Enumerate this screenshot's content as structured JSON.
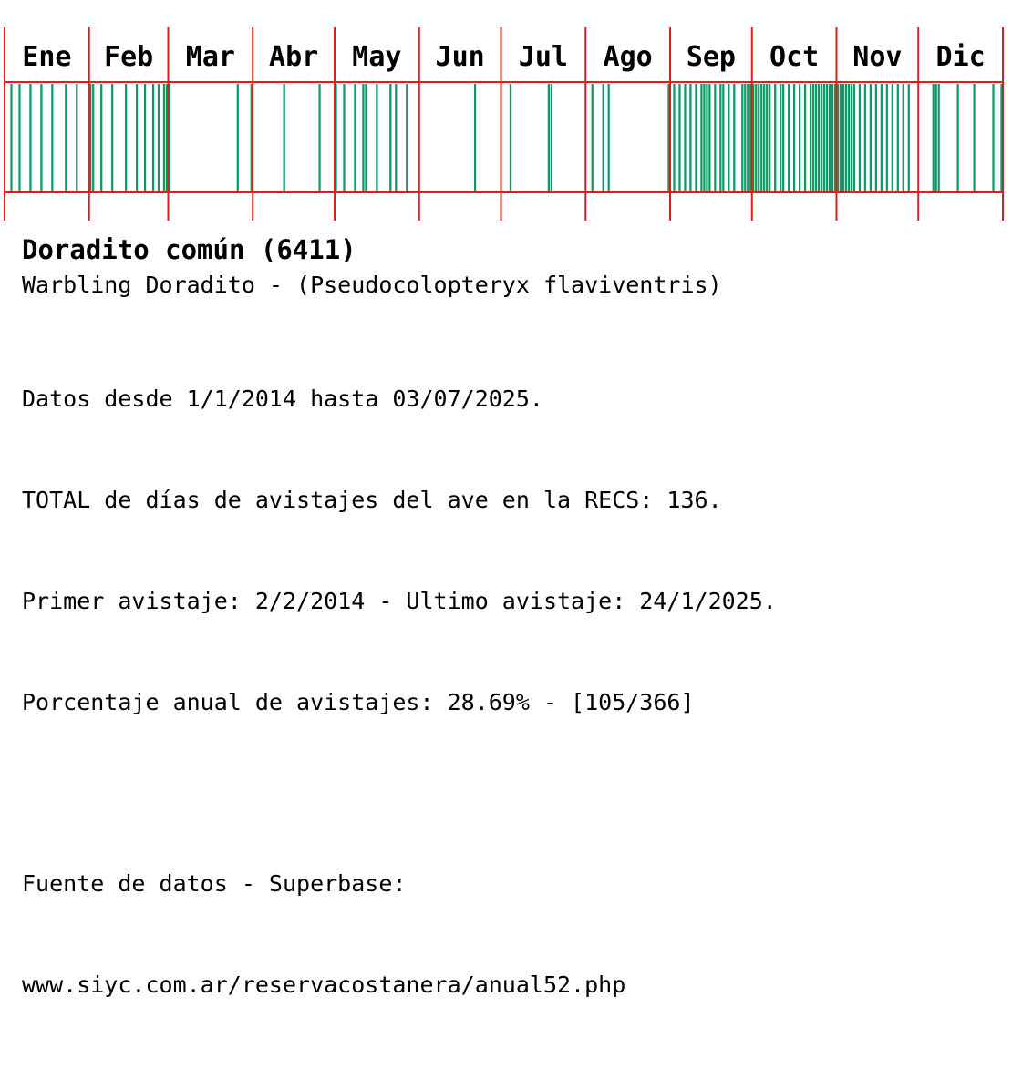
{
  "chart_data": {
    "type": "heatmap",
    "title": "",
    "months": [
      "Ene",
      "Feb",
      "Mar",
      "Abr",
      "May",
      "Jun",
      "Jul",
      "Ago",
      "Sep",
      "Oct",
      "Nov",
      "Dic"
    ],
    "days_in_months": [
      31,
      29,
      31,
      30,
      31,
      30,
      31,
      31,
      30,
      31,
      30,
      31
    ],
    "sighting_days_of_year": [
      3,
      6,
      10,
      14,
      18,
      23,
      27,
      32,
      33,
      36,
      40,
      45,
      49,
      52,
      55,
      57,
      59,
      60,
      61,
      86,
      91,
      103,
      116,
      122,
      125,
      129,
      132,
      133,
      137,
      142,
      144,
      148,
      173,
      186,
      200,
      201,
      216,
      220,
      222,
      244,
      246,
      248,
      250,
      252,
      254,
      256,
      257,
      258,
      259,
      261,
      263,
      264,
      266,
      268,
      271,
      272,
      273,
      274,
      275,
      276,
      277,
      278,
      279,
      280,
      281,
      283,
      285,
      286,
      288,
      290,
      292,
      294,
      296,
      297,
      298,
      299,
      300,
      301,
      302,
      303,
      304,
      305,
      306,
      307,
      308,
      309,
      310,
      311,
      312,
      314,
      316,
      318,
      320,
      322,
      324,
      326,
      328,
      330,
      332,
      341,
      342,
      343,
      350,
      356,
      363,
      366
    ],
    "colors": {
      "sighting": "#0c9b67",
      "grid": "#e51b1b",
      "background": "#ffffff"
    }
  },
  "species": {
    "name": "Doradito común (6411)",
    "subtitle": "Warbling Doradito - (Pseudocolopteryx flaviventris)"
  },
  "stats": {
    "range": "Datos desde 1/1/2014 hasta 03/07/2025.",
    "total": "TOTAL de días de avistajes del ave en la RECS: 136.",
    "first_last": "Primer avistaje: 2/2/2014 - Ultimo avistaje: 24/1/2025.",
    "percentage": "Porcentaje anual de avistajes: 28.69% - [105/366]"
  },
  "source": {
    "label": "Fuente de datos - Superbase:",
    "url": "www.siyc.com.ar/reservacostanera/anual52.php"
  }
}
